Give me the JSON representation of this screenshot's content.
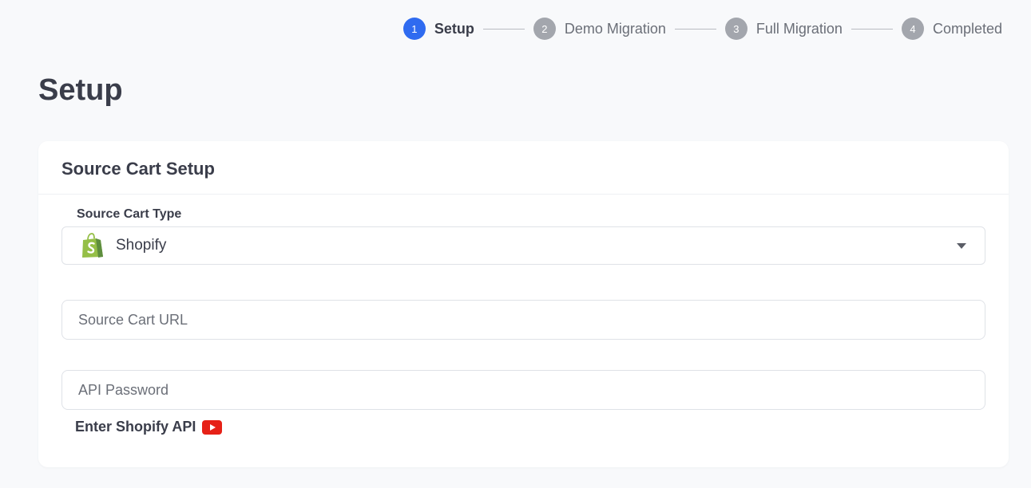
{
  "stepper": {
    "steps": [
      {
        "number": "1",
        "label": "Setup"
      },
      {
        "number": "2",
        "label": "Demo Migration"
      },
      {
        "number": "3",
        "label": "Full Migration"
      },
      {
        "number": "4",
        "label": "Completed"
      }
    ],
    "active_step": "1"
  },
  "page": {
    "title": "Setup"
  },
  "card": {
    "title": "Source Cart Setup",
    "cart_type": {
      "label": "Source Cart Type",
      "selected_value": "Shopify",
      "icon": "shopify-logo-icon"
    },
    "cart_url": {
      "placeholder": "Source Cart URL",
      "value": ""
    },
    "api_password": {
      "placeholder": "API Password",
      "value": ""
    },
    "helper_link": {
      "label": "Enter Shopify API",
      "icon": "youtube-icon"
    }
  },
  "colors": {
    "accent": "#2f6bf0",
    "inactive_step": "#a3a6ad",
    "shopify_green": "#95bf47",
    "youtube_red": "#e62117"
  }
}
